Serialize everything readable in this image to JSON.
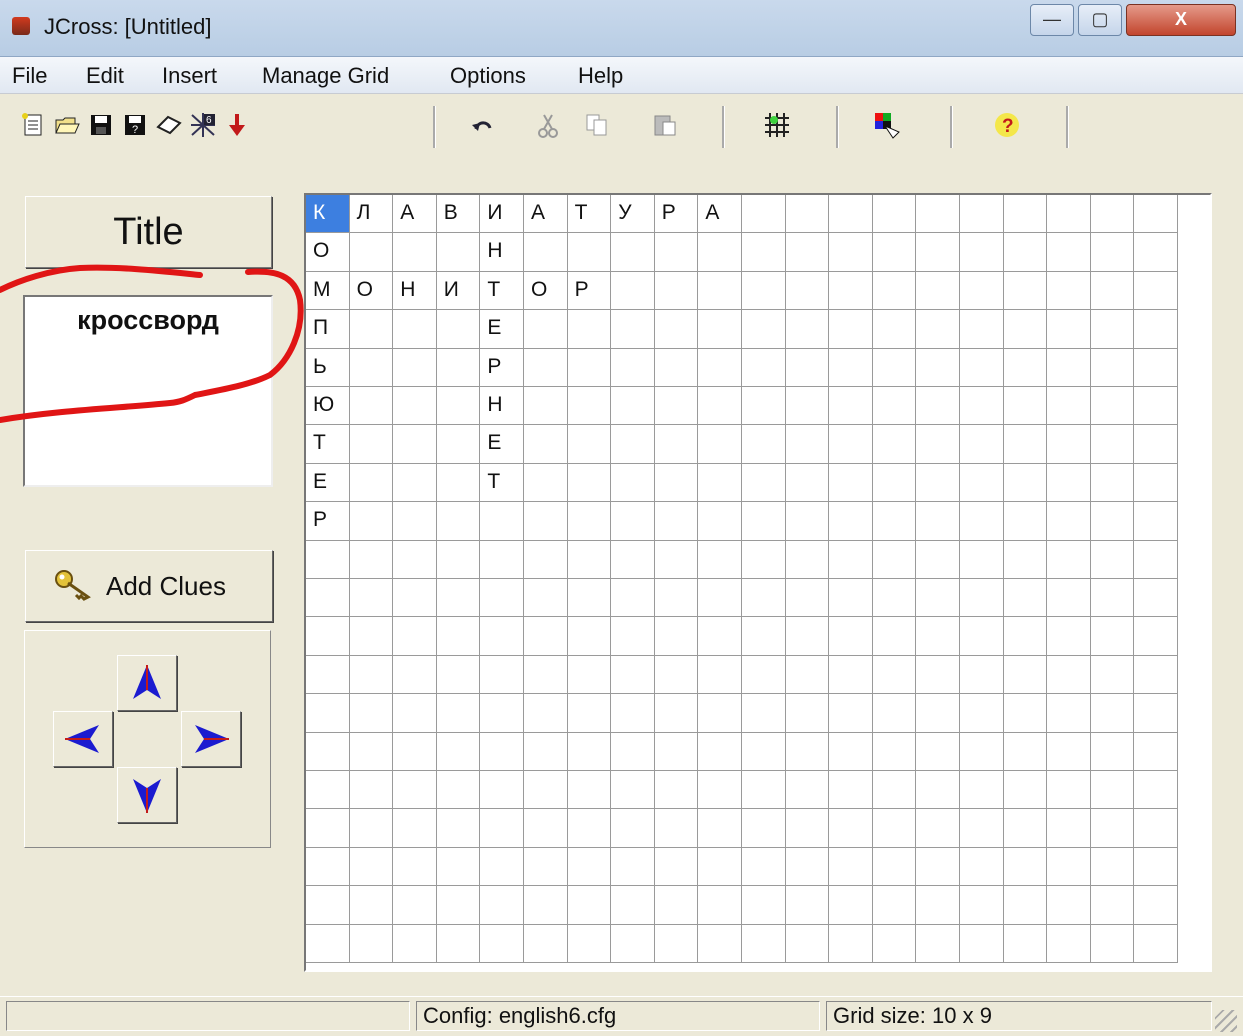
{
  "window": {
    "title": "JCross: [Untitled]",
    "min_symbol": "—",
    "max_symbol": "▢",
    "close_symbol": "X"
  },
  "menu": [
    "File",
    "Edit",
    "Insert",
    "Manage Grid",
    "Options",
    "Help"
  ],
  "toolbar": {
    "icons": [
      "new-file-icon",
      "open-folder-icon",
      "save-icon",
      "save-as-icon",
      "erase-icon",
      "grid-number-icon",
      "down-arrow-icon",
      "undo-icon",
      "cut-icon",
      "copy-icon",
      "paste-icon",
      "grid-icon",
      "colors-icon",
      "help-icon"
    ]
  },
  "left_panel": {
    "title_button": "Title",
    "title_text": "кроссворд",
    "add_clues": "Add Clues"
  },
  "grid": {
    "rows": [
      [
        "К",
        "Л",
        "А",
        "В",
        "И",
        "А",
        "Т",
        "У",
        "Р",
        "А"
      ],
      [
        "О",
        "",
        "",
        "",
        "Н",
        "",
        "",
        "",
        "",
        ""
      ],
      [
        "М",
        "О",
        "Н",
        "И",
        "Т",
        "О",
        "Р",
        "",
        "",
        ""
      ],
      [
        "П",
        "",
        "",
        "",
        "Е",
        "",
        "",
        "",
        "",
        ""
      ],
      [
        "Ь",
        "",
        "",
        "",
        "Р",
        "",
        "",
        "",
        "",
        ""
      ],
      [
        "Ю",
        "",
        "",
        "",
        "Н",
        "",
        "",
        "",
        "",
        ""
      ],
      [
        "Т",
        "",
        "",
        "",
        "Е",
        "",
        "",
        "",
        "",
        ""
      ],
      [
        "Е",
        "",
        "",
        "",
        "Т",
        "",
        "",
        "",
        "",
        ""
      ],
      [
        "Р",
        "",
        "",
        "",
        "",
        "",
        "",
        "",
        "",
        ""
      ]
    ],
    "selected": "К"
  },
  "status": {
    "config": "Config: english6.cfg",
    "grid_size": "Grid size: 10 x 9"
  }
}
